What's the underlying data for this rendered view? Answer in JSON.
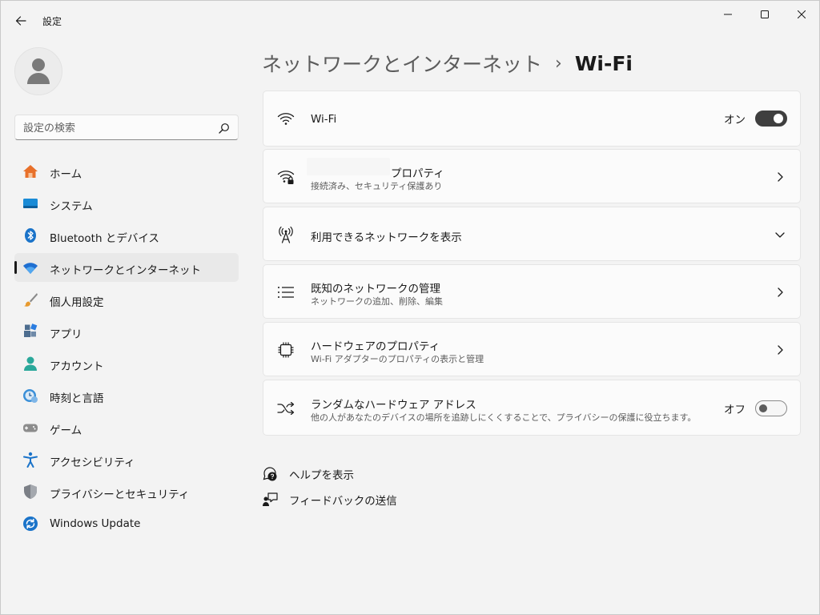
{
  "window": {
    "title": "設定"
  },
  "sidebar": {
    "search_placeholder": "設定の検索",
    "items": [
      {
        "label": "ホーム",
        "icon": "home-icon"
      },
      {
        "label": "システム",
        "icon": "system-icon"
      },
      {
        "label": "Bluetooth とデバイス",
        "icon": "bluetooth-icon"
      },
      {
        "label": "ネットワークとインターネット",
        "icon": "network-icon",
        "selected": true
      },
      {
        "label": "個人用設定",
        "icon": "brush-icon"
      },
      {
        "label": "アプリ",
        "icon": "apps-icon"
      },
      {
        "label": "アカウント",
        "icon": "account-icon"
      },
      {
        "label": "時刻と言語",
        "icon": "time-language-icon"
      },
      {
        "label": "ゲーム",
        "icon": "gamepad-icon"
      },
      {
        "label": "アクセシビリティ",
        "icon": "accessibility-icon"
      },
      {
        "label": "プライバシーとセキュリティ",
        "icon": "shield-icon"
      },
      {
        "label": "Windows Update",
        "icon": "update-icon"
      }
    ]
  },
  "breadcrumb": {
    "parent": "ネットワークとインターネット",
    "separator": "›",
    "current": "Wi-Fi"
  },
  "cards": {
    "wifi": {
      "title": "Wi-Fi",
      "toggle_label": "オン",
      "toggle_on": true
    },
    "properties": {
      "title": "プロパティ",
      "subtitle": "接続済み、セキュリティ保護あり"
    },
    "available": {
      "title": "利用できるネットワークを表示"
    },
    "known": {
      "title": "既知のネットワークの管理",
      "subtitle": "ネットワークの追加、削除、編集"
    },
    "hardware": {
      "title": "ハードウェアのプロパティ",
      "subtitle": "Wi-Fi アダプターのプロパティの表示と管理"
    },
    "random": {
      "title": "ランダムなハードウェア アドレス",
      "subtitle": "他の人があなたのデバイスの場所を追跡しにくくすることで、プライバシーの保護に役立ちます。",
      "toggle_label": "オフ",
      "toggle_on": false
    }
  },
  "footer": {
    "help": "ヘルプを表示",
    "feedback": "フィードバックの送信"
  },
  "colors": {
    "accent": "#0067c0",
    "toggle_on": "#3f3f3f",
    "background": "#f3f3f3",
    "card": "#fbfbfb"
  }
}
